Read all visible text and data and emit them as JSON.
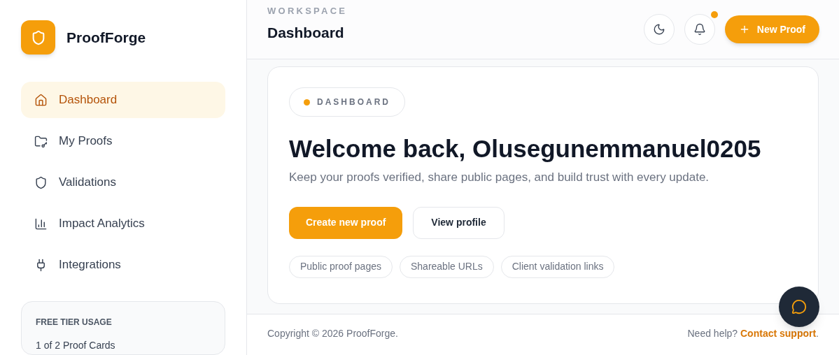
{
  "brand": {
    "name": "ProofForge"
  },
  "sidebar": {
    "items": [
      {
        "label": "Dashboard",
        "kind": "home",
        "selected": true
      },
      {
        "label": "My Proofs",
        "kind": "folder",
        "selected": false
      },
      {
        "label": "Validations",
        "kind": "shield",
        "selected": false
      },
      {
        "label": "Impact Analytics",
        "kind": "chart",
        "selected": false
      },
      {
        "label": "Integrations",
        "kind": "plug",
        "selected": false
      }
    ],
    "usage": {
      "title": "FREE TIER USAGE",
      "text": "1 of 2 Proof Cards"
    }
  },
  "header": {
    "eyebrow": "WORKSPACE",
    "title": "Dashboard",
    "notification_dot": true,
    "new_button": "New Proof"
  },
  "hero": {
    "badge": "DASHBOARD",
    "heading": "Welcome back, Olusegunemmanuel0205",
    "subtitle": "Keep your proofs verified, share public pages, and build trust with every update.",
    "primary_button": "Create new proof",
    "secondary_button": "View profile",
    "chips": [
      "Public proof pages",
      "Shareable URLs",
      "Client validation links"
    ]
  },
  "footer": {
    "copyright": "Copyright © 2026 ProofForge.",
    "help": "Need help?",
    "link": "Contact support",
    "end": "."
  }
}
